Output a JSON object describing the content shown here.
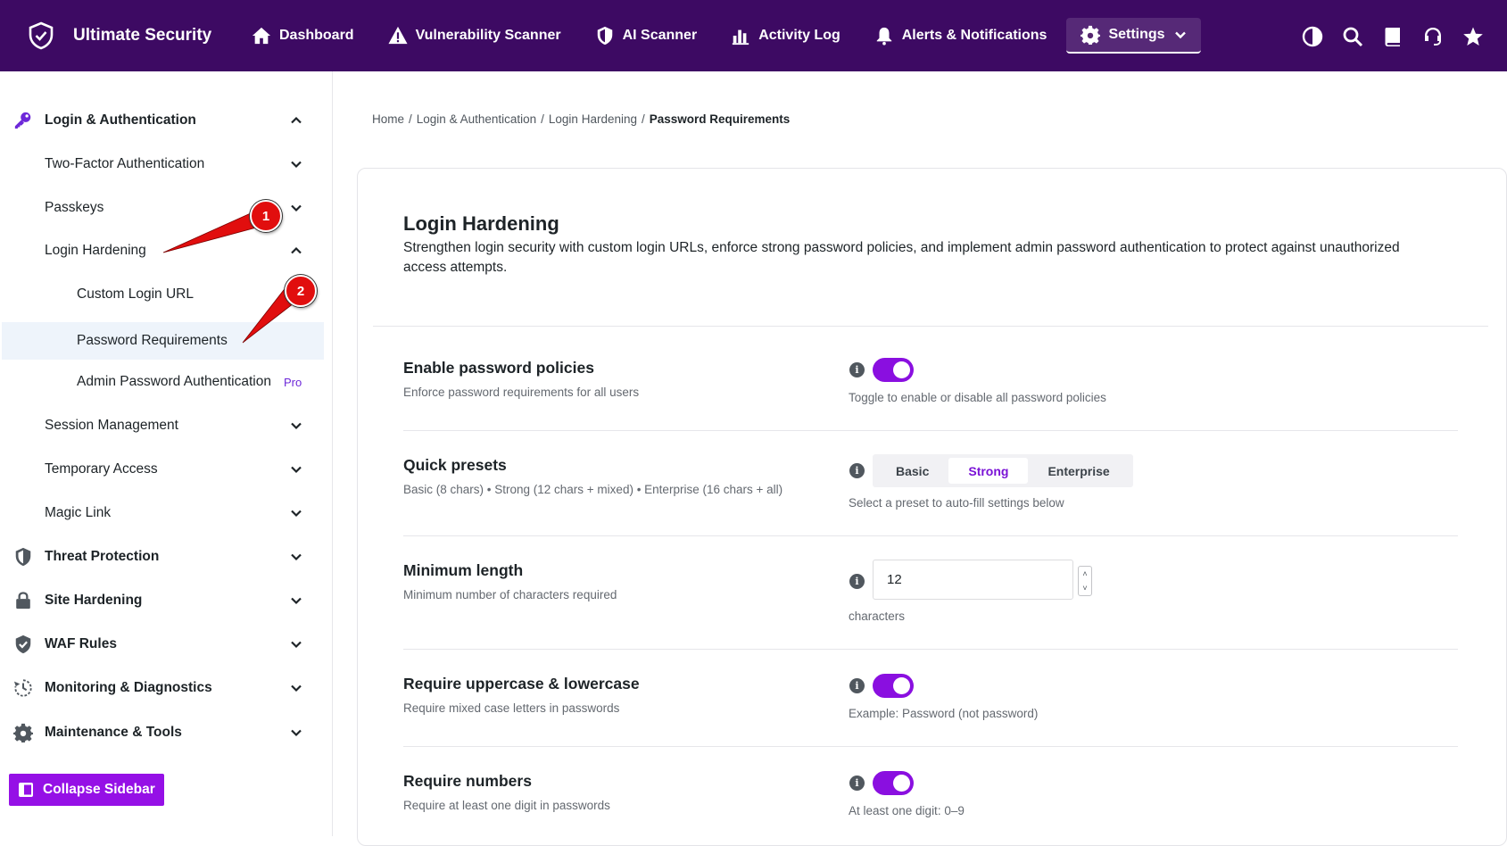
{
  "brand": {
    "name": "Ultimate Security",
    "logo": "shield-check-icon"
  },
  "nav": [
    {
      "label": "Dashboard",
      "icon": "home-icon"
    },
    {
      "label": "Vulnerability Scanner",
      "icon": "warning-icon"
    },
    {
      "label": "AI Scanner",
      "icon": "shield-icon"
    },
    {
      "label": "Activity Log",
      "icon": "bar-chart-icon"
    },
    {
      "label": "Alerts & Notifications",
      "icon": "bell-icon"
    },
    {
      "label": "Settings",
      "icon": "gear-icon",
      "active": true
    }
  ],
  "top_icons": [
    "theme-toggle-icon",
    "search-icon",
    "docs-book-icon",
    "support-headset-icon",
    "star-icon"
  ],
  "sidebar": {
    "items": [
      {
        "label": "Login & Authentication",
        "icon": "key-icon",
        "expanded": true
      },
      {
        "label": "Two-Factor Authentication"
      },
      {
        "label": "Passkeys"
      },
      {
        "label": "Login Hardening",
        "expanded": true
      },
      {
        "label": "Custom Login URL"
      },
      {
        "label": "Password Requirements",
        "selected": true
      },
      {
        "label": "Admin Password Authentication",
        "badge": "Pro"
      },
      {
        "label": "Session Management"
      },
      {
        "label": "Temporary Access"
      },
      {
        "label": "Magic Link"
      },
      {
        "label": "Threat Protection",
        "icon": "shield-icon"
      },
      {
        "label": "Site Hardening",
        "icon": "lock-icon"
      },
      {
        "label": "WAF Rules",
        "icon": "shield-check-icon"
      },
      {
        "label": "Monitoring & Diagnostics",
        "icon": "history-icon"
      },
      {
        "label": "Maintenance & Tools",
        "icon": "gear-icon"
      }
    ],
    "collapse_label": "Collapse Sidebar"
  },
  "annotations": [
    "1",
    "2"
  ],
  "breadcrumb": [
    "Home",
    "Login & Authentication",
    "Login Hardening",
    "Password Requirements"
  ],
  "breadcrumb_sep": "/",
  "page": {
    "title": "Login Hardening",
    "description": "Strengthen login security with custom login URLs, enforce strong password policies, and implement admin password authentication to protect against unauthorized access attempts."
  },
  "settings": {
    "enable_policies": {
      "title": "Enable password policies",
      "desc": "Enforce password requirements for all users",
      "hint": "Toggle to enable or disable all password policies",
      "on": true
    },
    "presets": {
      "title": "Quick presets",
      "desc": "Basic (8 chars) • Strong (12 chars + mixed) • Enterprise (16 chars + all)",
      "options": [
        "Basic",
        "Strong",
        "Enterprise"
      ],
      "selected": "Strong",
      "hint": "Select a preset to auto-fill settings below"
    },
    "min_length": {
      "title": "Minimum length",
      "desc": "Minimum number of characters required",
      "value": "12",
      "unit": "characters"
    },
    "upper_lower": {
      "title": "Require uppercase & lowercase",
      "desc": "Require mixed case letters in passwords",
      "hint": "Example: Password (not password)",
      "on": true
    },
    "numbers": {
      "title": "Require numbers",
      "desc": "Require at least one digit in passwords",
      "hint": "At least one digit: 0–9",
      "on": true
    }
  },
  "info_glyph": "i",
  "stepper_glyphs": {
    "up": "˄",
    "down": "˅"
  },
  "colors": {
    "topbar": "#3d0a63",
    "accent": "#8a0fe0",
    "marker": "#e10e0e",
    "selected_bg": "#eef4fb"
  }
}
